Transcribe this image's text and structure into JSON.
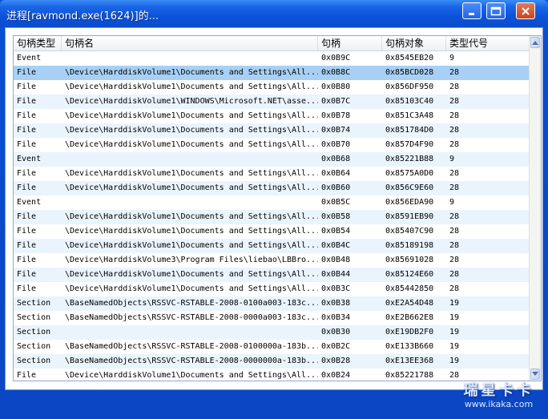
{
  "window": {
    "title": "进程[ravmond.exe(1624)]的..."
  },
  "columns": {
    "type": "句柄类型",
    "name": "句柄名",
    "handle": "句柄",
    "object": "句柄对象",
    "code": "类型代号"
  },
  "rows": [
    {
      "type": "Event",
      "name": "",
      "handle": "0x0B9C",
      "object": "0x8545EB20",
      "code": "9"
    },
    {
      "type": "File",
      "name": "\\Device\\HarddiskVolume1\\Documents and Settings\\All...",
      "handle": "0x0B8C",
      "object": "0x85BCD028",
      "code": "28"
    },
    {
      "type": "File",
      "name": "\\Device\\HarddiskVolume1\\Documents and Settings\\All...",
      "handle": "0x0B80",
      "object": "0x856DF950",
      "code": "28"
    },
    {
      "type": "File",
      "name": "\\Device\\HarddiskVolume1\\WINDOWS\\Microsoft.NET\\asse...",
      "handle": "0x0B7C",
      "object": "0x85103C40",
      "code": "28"
    },
    {
      "type": "File",
      "name": "\\Device\\HarddiskVolume1\\Documents and Settings\\All...",
      "handle": "0x0B78",
      "object": "0x851C3A48",
      "code": "28"
    },
    {
      "type": "File",
      "name": "\\Device\\HarddiskVolume1\\Documents and Settings\\All...",
      "handle": "0x0B74",
      "object": "0x851784D0",
      "code": "28"
    },
    {
      "type": "File",
      "name": "\\Device\\HarddiskVolume1\\Documents and Settings\\All...",
      "handle": "0x0B70",
      "object": "0x857D4F90",
      "code": "28"
    },
    {
      "type": "Event",
      "name": "",
      "handle": "0x0B68",
      "object": "0x85221B88",
      "code": "9"
    },
    {
      "type": "File",
      "name": "\\Device\\HarddiskVolume1\\Documents and Settings\\All...",
      "handle": "0x0B64",
      "object": "0x8575A0D0",
      "code": "28"
    },
    {
      "type": "File",
      "name": "\\Device\\HarddiskVolume1\\Documents and Settings\\All...",
      "handle": "0x0B60",
      "object": "0x856C9E60",
      "code": "28"
    },
    {
      "type": "Event",
      "name": "",
      "handle": "0x0B5C",
      "object": "0x856EDA90",
      "code": "9"
    },
    {
      "type": "File",
      "name": "\\Device\\HarddiskVolume1\\Documents and Settings\\All...",
      "handle": "0x0B58",
      "object": "0x8591EB90",
      "code": "28"
    },
    {
      "type": "File",
      "name": "\\Device\\HarddiskVolume1\\Documents and Settings\\All...",
      "handle": "0x0B54",
      "object": "0x85407C90",
      "code": "28"
    },
    {
      "type": "File",
      "name": "\\Device\\HarddiskVolume1\\Documents and Settings\\All...",
      "handle": "0x0B4C",
      "object": "0x85189198",
      "code": "28"
    },
    {
      "type": "File",
      "name": "\\Device\\HarddiskVolume3\\Program Files\\liebao\\LBBro...",
      "handle": "0x0B48",
      "object": "0x85691028",
      "code": "28"
    },
    {
      "type": "File",
      "name": "\\Device\\HarddiskVolume1\\Documents and Settings\\All...",
      "handle": "0x0B44",
      "object": "0x85124E60",
      "code": "28"
    },
    {
      "type": "File",
      "name": "\\Device\\HarddiskVolume1\\Documents and Settings\\All...",
      "handle": "0x0B3C",
      "object": "0x85442850",
      "code": "28"
    },
    {
      "type": "Section",
      "name": "\\BaseNamedObjects\\RSSVC-RSTABLE-2008-0100a003-183c...",
      "handle": "0x0B38",
      "object": "0xE2A54D48",
      "code": "19"
    },
    {
      "type": "Section",
      "name": "\\BaseNamedObjects\\RSSVC-RSTABLE-2008-0000a003-183c...",
      "handle": "0x0B34",
      "object": "0xE2B662E8",
      "code": "19"
    },
    {
      "type": "Section",
      "name": "",
      "handle": "0x0B30",
      "object": "0xE19DB2F0",
      "code": "19"
    },
    {
      "type": "Section",
      "name": "\\BaseNamedObjects\\RSSVC-RSTABLE-2008-0100000a-183b...",
      "handle": "0x0B2C",
      "object": "0xE133B660",
      "code": "19"
    },
    {
      "type": "Section",
      "name": "\\BaseNamedObjects\\RSSVC-RSTABLE-2008-0000000a-183b...",
      "handle": "0x0B28",
      "object": "0xE13EE368",
      "code": "19"
    },
    {
      "type": "File",
      "name": "\\Device\\HarddiskVolume1\\Documents and Settings\\All...",
      "handle": "0x0B24",
      "object": "0x85221788",
      "code": "28"
    }
  ],
  "selected_row": 1,
  "watermark": {
    "brand": "瑞星卡卡",
    "url": "www.ikaka.com"
  }
}
